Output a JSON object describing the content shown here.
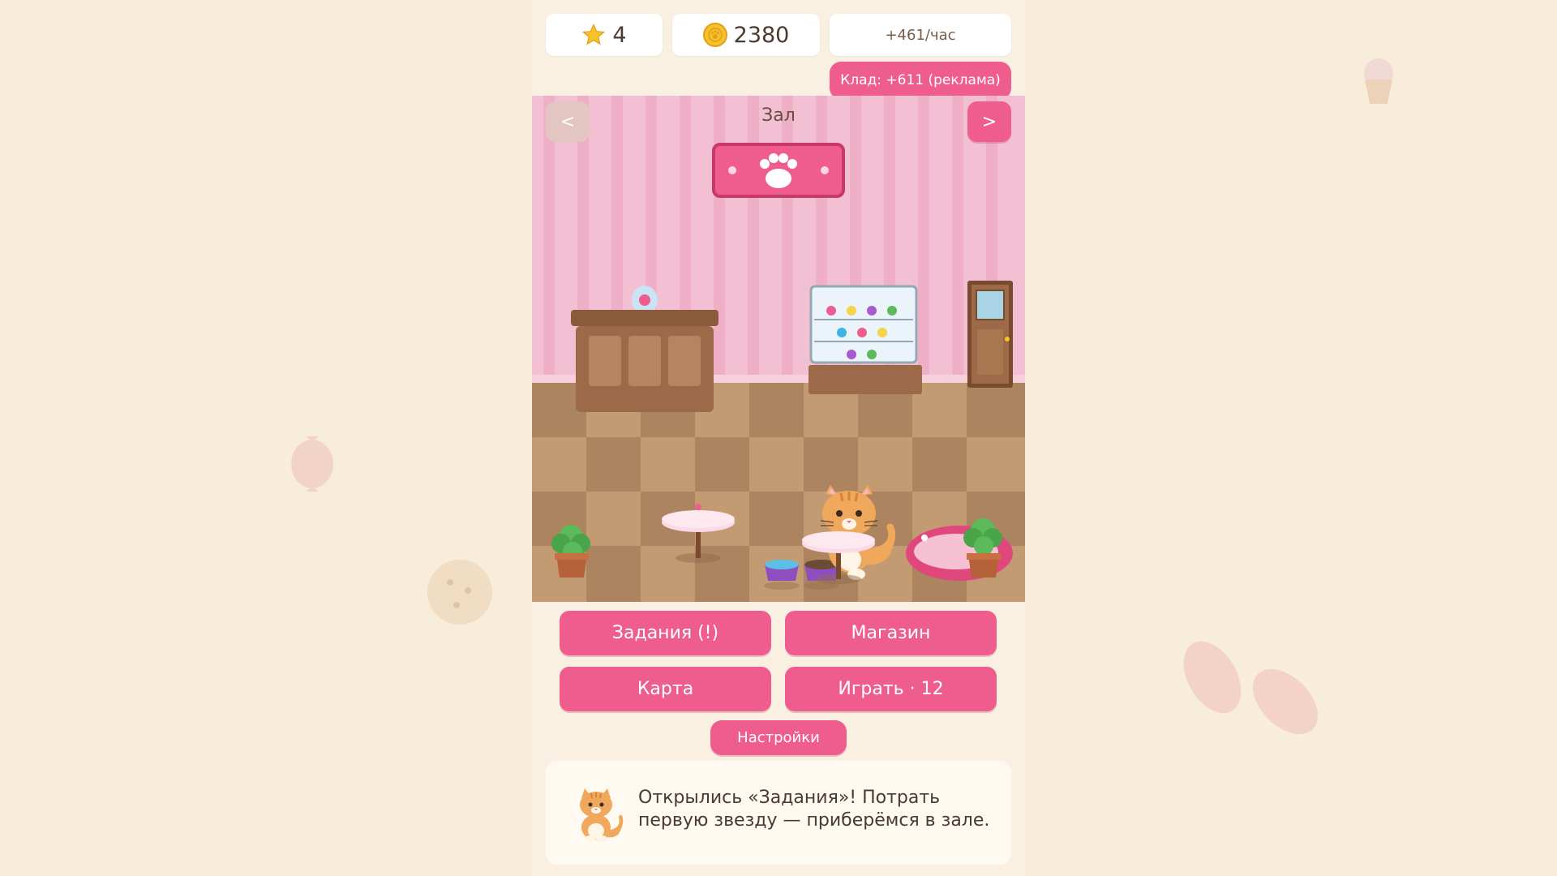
{
  "header": {
    "stars": {
      "icon": "star-icon",
      "value": "4"
    },
    "coins": {
      "icon": "coin-icon",
      "value": "2380"
    },
    "income_rate": "+461/час",
    "treasure_button": "Клад: +611 (реклама)"
  },
  "room": {
    "title": "Зал",
    "prev_label": "<",
    "next_label": ">"
  },
  "menu": {
    "tasks": "Задания (!)",
    "shop": "Магазин",
    "map": "Карта",
    "play": "Играть · 12",
    "settings": "Настройки"
  },
  "dialog": {
    "speaker_icon": "cat-icon",
    "text": "Открылись «Задания»! Потрать первую звезду — приберёмся в зале."
  },
  "colors": {
    "accent": "#ee5d8d",
    "background": "#f8ecdb",
    "wall": "#f3bfd3",
    "floor_light": "#c39b73",
    "floor_dark": "#ad8460"
  }
}
